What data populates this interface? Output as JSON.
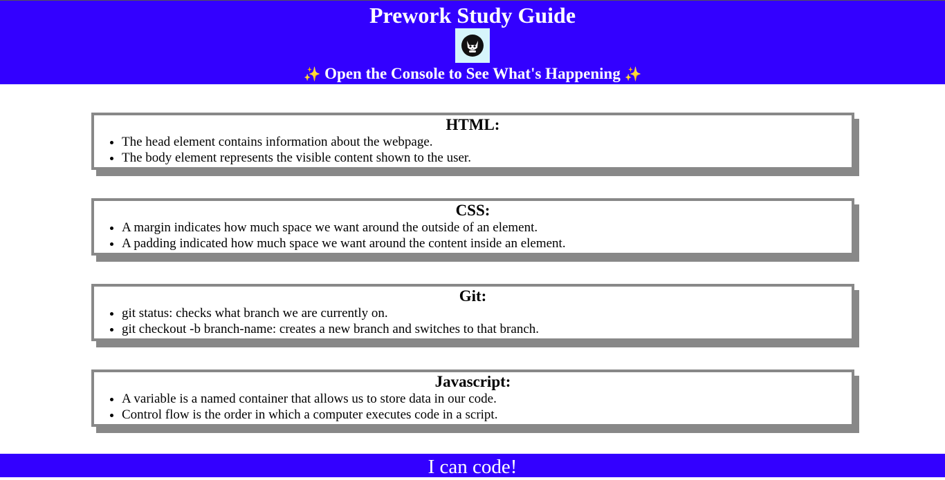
{
  "header": {
    "title": "Prework Study Guide",
    "subtitle": "Open the Console to See What's Happening",
    "sparkle": "✨"
  },
  "colors": {
    "header_bg": "#3300ff",
    "footer_bg": "#3300ff",
    "card_border": "#888888",
    "logo_bg": "#d6f5fb"
  },
  "sections": [
    {
      "heading": "HTML:",
      "items": [
        "The head element contains information about the webpage.",
        "The body element represents the visible content shown to the user."
      ]
    },
    {
      "heading": "CSS:",
      "items": [
        "A margin indicates how much space we want around the outside of an element.",
        "A padding indicated how much space we want around the content inside an element."
      ]
    },
    {
      "heading": "Git:",
      "items": [
        "git status: checks what branch we are currently on.",
        "git checkout -b branch-name: creates a new branch and switches to that branch."
      ]
    },
    {
      "heading": "Javascript:",
      "items": [
        "A variable is a named container that allows us to store data in our code.",
        "Control flow is the order in which a computer executes code in a script."
      ]
    }
  ],
  "footer": {
    "text": "I can code!"
  }
}
